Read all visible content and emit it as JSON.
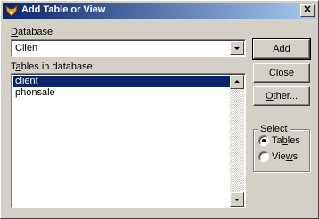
{
  "window": {
    "title": "Add Table or View",
    "close_glyph": "✕"
  },
  "database": {
    "label_accel": "D",
    "label_rest": "atabase",
    "selected_value": "Clien",
    "options": [
      "Clien"
    ]
  },
  "tables": {
    "label_pre": "T",
    "label_accel": "a",
    "label_rest": "bles in database:",
    "items": [
      {
        "label": "client",
        "selected": true
      },
      {
        "label": "phonsale",
        "selected": false
      }
    ]
  },
  "buttons": {
    "add": {
      "accel": "A",
      "rest": "dd"
    },
    "close": {
      "accel": "C",
      "rest": "lose"
    },
    "other": {
      "accel": "O",
      "rest": "ther..."
    }
  },
  "select_group": {
    "title": "Select",
    "options": [
      {
        "pre": "Ta",
        "accel": "b",
        "rest": "les",
        "checked": true
      },
      {
        "pre": "Vie",
        "accel": "w",
        "rest": "s",
        "checked": false
      }
    ]
  },
  "icons": {
    "app": "fox-head-icon",
    "close": "close-icon",
    "combo_arrow": "chevron-down-icon",
    "scroll_up": "scroll-up-arrow-icon",
    "scroll_down": "scroll-down-arrow-icon"
  },
  "colors": {
    "titlebar_start": "#0a246a",
    "titlebar_end": "#a6caf0",
    "selection": "#0a246a",
    "face": "#d4d0c8"
  }
}
